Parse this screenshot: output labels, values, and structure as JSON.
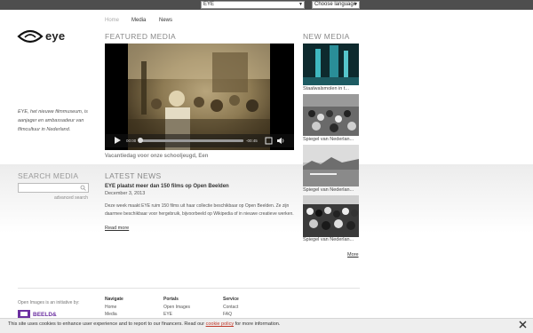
{
  "topbar": {
    "channel_select": "EYE",
    "language_select": "Choose language"
  },
  "brand": {
    "logo_text": "eye",
    "tagline": "EYE, het nieuwe filmmuseum, is aanjager en ambassadeur van filmcultuur in Nederland."
  },
  "nav": {
    "home": "Home",
    "media": "Media",
    "news": "News"
  },
  "featured": {
    "title": "FEATURED MEDIA",
    "caption": "Vacantiedag voor onze schooljeugd, Een",
    "player": {
      "time_current": "00:00",
      "time_total": "-00:45",
      "progress": 0.0
    }
  },
  "search": {
    "title": "SEARCH MEDIA",
    "placeholder": "",
    "advanced": "advanced search"
  },
  "latest_news": {
    "title": "LATEST NEWS",
    "headline": "EYE plaatst meer dan 150 films op Open Beelden",
    "date": "December 3, 2013",
    "body": "Deze week maakt EYE ruim 150 films uit haar collectie beschikbaar op Open Beelden. Ze zijn daarmee beschikbaar voor hergebruik, bijvoorbeeld op Wikipedia of in nieuwe creatieve werken.",
    "read_more": "Read more"
  },
  "new_media": {
    "title": "NEW MEDIA",
    "items": [
      {
        "caption": "Staalwalsmolen in t..."
      },
      {
        "caption": "Spiegel van Nederlan..."
      },
      {
        "caption": "Spiegel van Nederlan..."
      },
      {
        "caption": "Spiegel van Nederlan..."
      }
    ],
    "more": "More"
  },
  "footer": {
    "note": "Open Images is an initiative by:",
    "logo_text": "BEELD&GELUID",
    "columns": [
      {
        "title": "Navigate",
        "items": [
          "Home",
          "Media"
        ]
      },
      {
        "title": "Portals",
        "items": [
          "Open Images",
          "EYE"
        ]
      },
      {
        "title": "Service",
        "items": [
          "Contact",
          "FAQ"
        ]
      }
    ]
  },
  "cookie": {
    "text_before": "This site uses cookies to enhance user experience and to report to our financers. Read our ",
    "link": "cookie policy",
    "text_after": " for more information."
  },
  "colors": {
    "topbar": "#4e4e4e",
    "section_title": "#888888",
    "cookie_link": "#c0392b"
  }
}
